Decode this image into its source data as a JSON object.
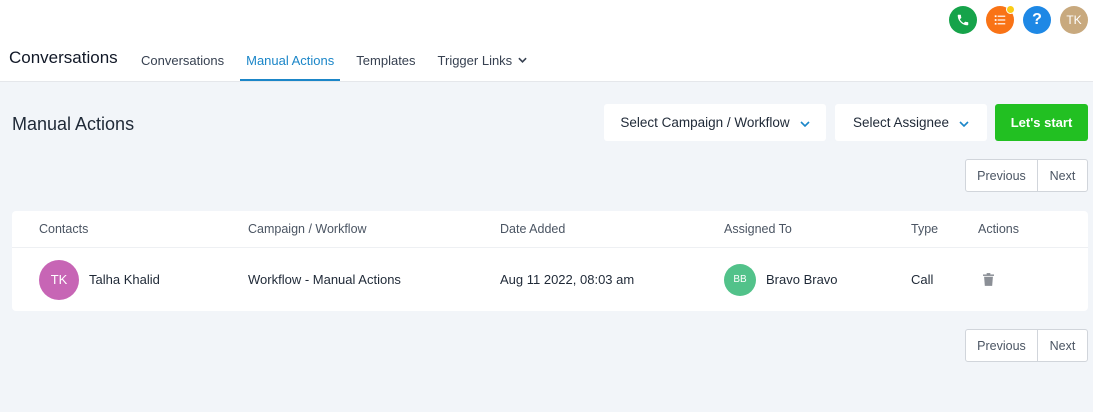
{
  "header": {
    "app_title": "Conversations",
    "icons": {
      "phone": "phone-icon",
      "tasks": "task-list-icon",
      "help": "?",
      "user_avatar": "TK"
    },
    "colors": {
      "phone": "#16a34a",
      "tasks": "#f97316",
      "help": "#1e88e5",
      "avatar": "#c8a97e"
    }
  },
  "nav": {
    "tabs": [
      {
        "label": "Conversations",
        "active": false
      },
      {
        "label": "Manual Actions",
        "active": true
      },
      {
        "label": "Templates",
        "active": false
      },
      {
        "label": "Trigger Links",
        "active": false,
        "has_dropdown": true
      }
    ],
    "accent": "#1b86c8"
  },
  "page": {
    "title": "Manual Actions",
    "filters": {
      "campaign_label": "Select Campaign / Workflow",
      "assignee_label": "Select Assignee"
    },
    "start_label": "Let's start",
    "start_color": "#22c022"
  },
  "pagination": {
    "previous": "Previous",
    "next": "Next"
  },
  "table": {
    "columns": [
      "Contacts",
      "Campaign / Workflow",
      "Date Added",
      "Assigned To",
      "Type",
      "Actions"
    ],
    "rows": [
      {
        "contact_initials": "TK",
        "contact_name": "Talha Khalid",
        "workflow": "Workflow - Manual Actions",
        "date_added": "Aug 11 2022, 08:03 am",
        "assignee_initials": "BB",
        "assignee_name": "Bravo Bravo",
        "type": "Call",
        "action_icon": "trash-icon"
      }
    ]
  }
}
